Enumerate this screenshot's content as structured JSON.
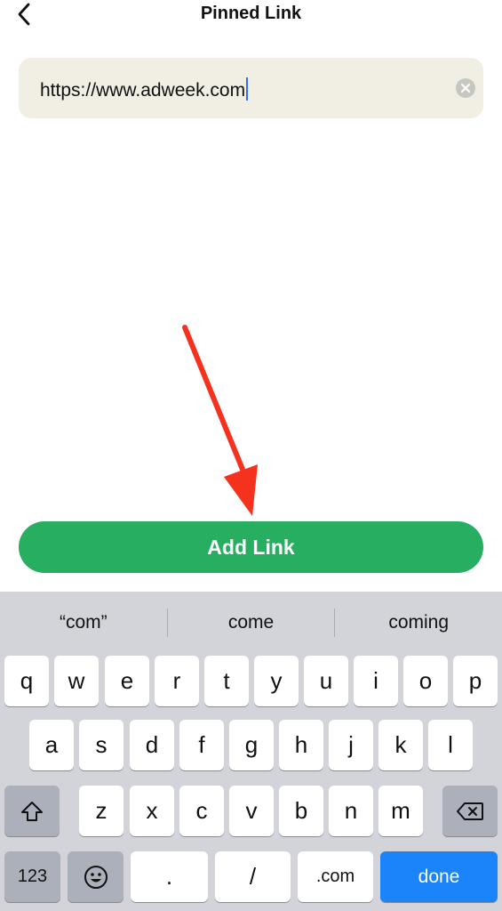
{
  "header": {
    "title": "Pinned Link",
    "back_icon": "chevron-left-icon"
  },
  "url_field": {
    "value": "https://www.adweek.com",
    "clear_icon": "clear-circle-icon"
  },
  "annotation": {
    "arrow_icon": "red-arrow-icon",
    "arrow_color": "#f5321e"
  },
  "add_button": {
    "label": "Add Link",
    "color": "#28ae60"
  },
  "keyboard": {
    "suggestions": [
      "“com”",
      "come",
      "coming"
    ],
    "row1": [
      "q",
      "w",
      "e",
      "r",
      "t",
      "y",
      "u",
      "i",
      "o",
      "p"
    ],
    "row2": [
      "a",
      "s",
      "d",
      "f",
      "g",
      "h",
      "j",
      "k",
      "l"
    ],
    "row3": [
      "z",
      "x",
      "c",
      "v",
      "b",
      "n",
      "m"
    ],
    "shift_icon": "shift-icon",
    "delete_icon": "backspace-icon",
    "numbers_label": "123",
    "emoji_icon": "emoji-icon",
    "period_label": ".",
    "slash_label": "/",
    "dotcom_label": ".com",
    "done_label": "done",
    "done_color": "#1c84f9"
  }
}
